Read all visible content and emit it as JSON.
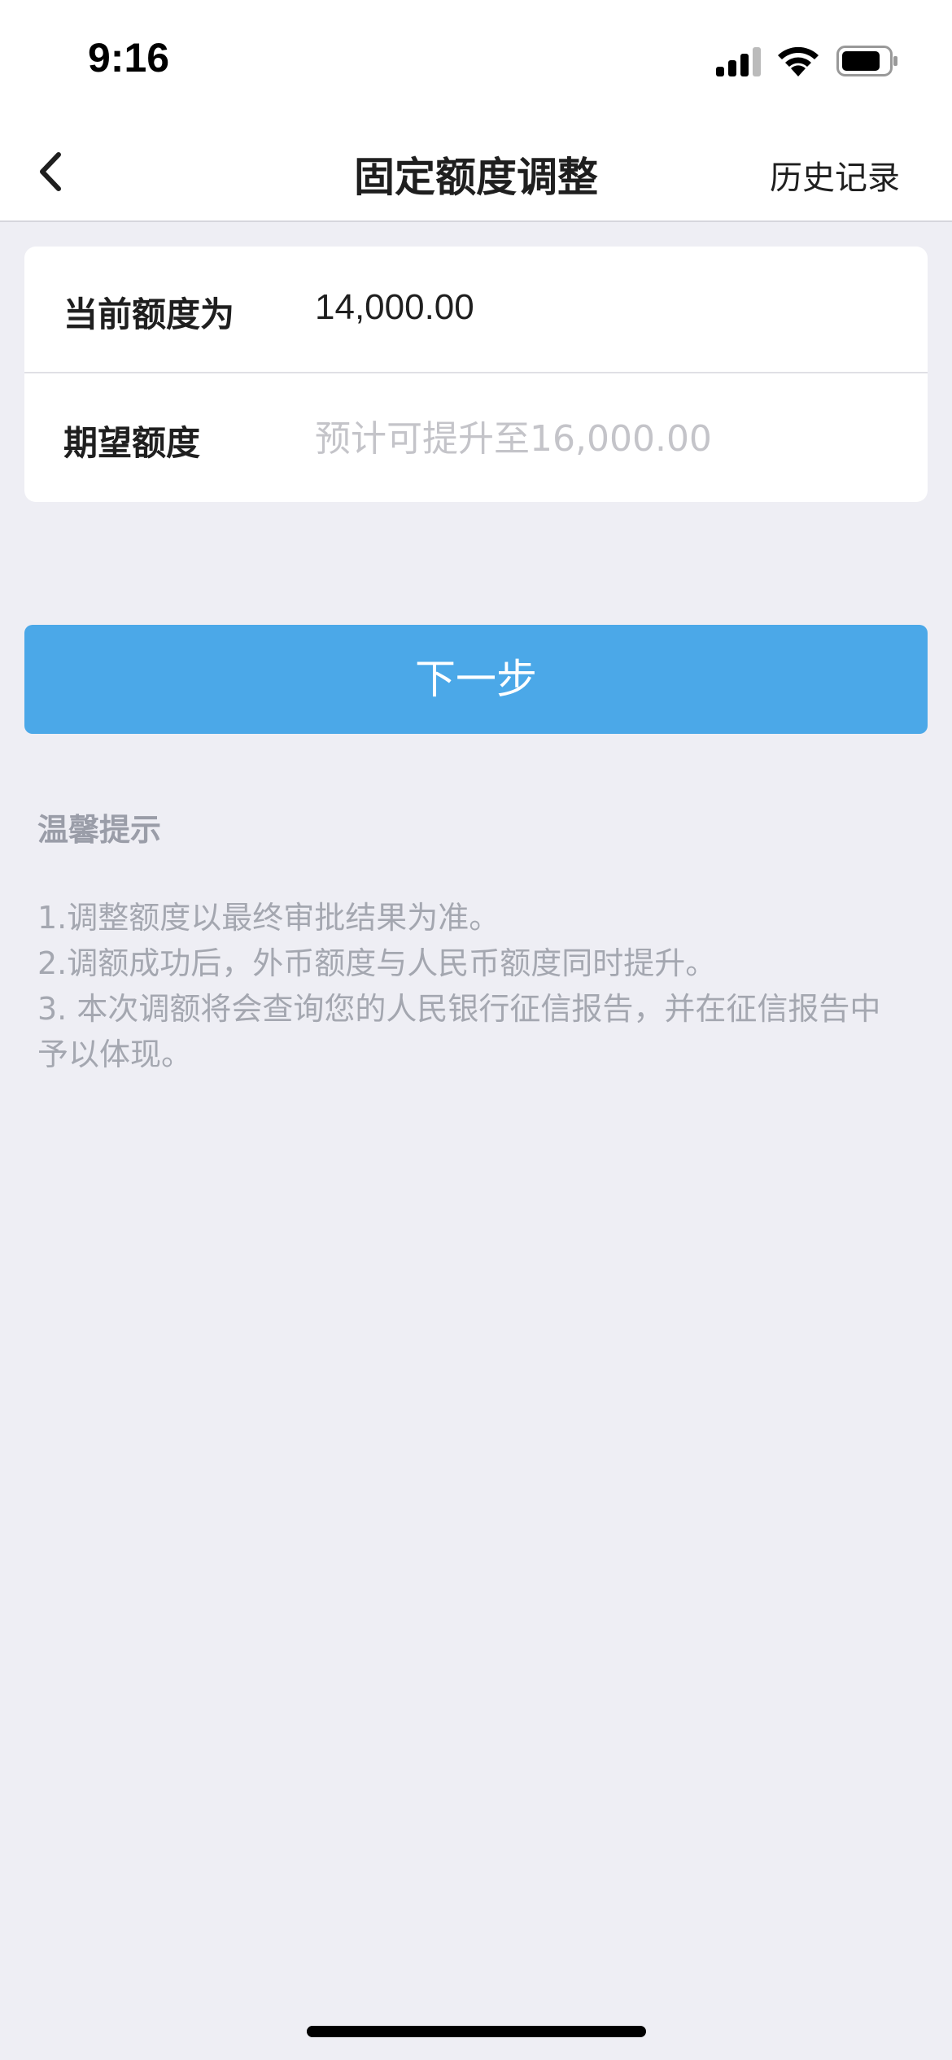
{
  "status_bar": {
    "time": "9:16"
  },
  "nav": {
    "title": "固定额度调整",
    "history_label": "历史记录"
  },
  "form": {
    "current_label": "当前额度为",
    "current_value": "14,000.00",
    "expected_label": "期望额度",
    "expected_placeholder": "预计可提升至16,000.00",
    "expected_value": ""
  },
  "next_button_label": "下一步",
  "tips": {
    "title": "温馨提示",
    "lines": [
      "1.调整额度以最终审批结果为准。",
      "2.调额成功后，外币额度与人民币额度同时提升。",
      "3. 本次调额将会查询您的人民银行征信报告，并在征信报告中",
      "予以体现。"
    ]
  },
  "colors": {
    "accent": "#4BA8E8",
    "background": "#EEEEF4",
    "tip_text": "#A4A7B0"
  }
}
